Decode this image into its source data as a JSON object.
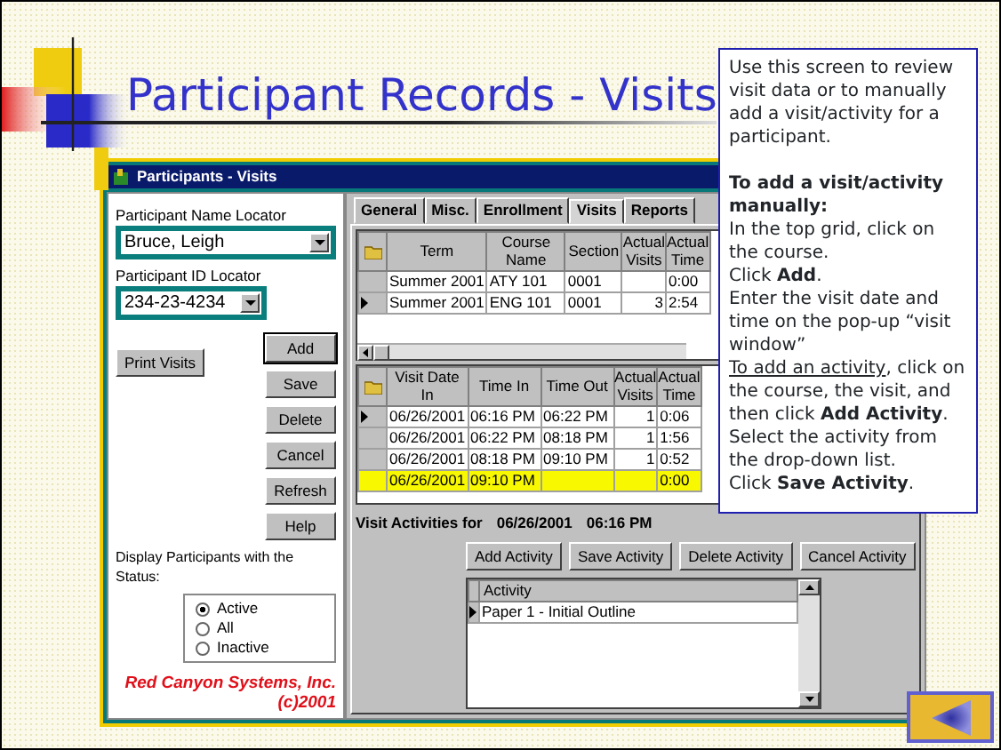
{
  "slide": {
    "title": "Participant Records - Visits"
  },
  "window": {
    "title": "Participants - Visits"
  },
  "left_panel": {
    "name_locator": {
      "label": "Participant Name Locator",
      "value": "Bruce, Leigh"
    },
    "id_locator": {
      "label": "Participant ID Locator",
      "value": "234-23-4234"
    },
    "print_button": "Print Visits",
    "buttons": [
      "Add",
      "Save",
      "Delete",
      "Cancel",
      "Refresh",
      "Help"
    ],
    "status_label": "Display Participants with the Status:",
    "status_options": [
      {
        "label": "Active",
        "selected": true
      },
      {
        "label": "All",
        "selected": false
      },
      {
        "label": "Inactive",
        "selected": false
      }
    ],
    "footer": [
      "Red Canyon Systems, Inc.",
      "(c)2001"
    ]
  },
  "tabs": [
    {
      "label": "General",
      "selected": false
    },
    {
      "label": "Misc.",
      "selected": false
    },
    {
      "label": "Enrollment",
      "selected": false
    },
    {
      "label": "Visits",
      "selected": true
    },
    {
      "label": "Reports",
      "selected": false
    }
  ],
  "courses_grid": {
    "columns": [
      "Term",
      "Course Name",
      "Section",
      "Actual Visits",
      "Actual Time"
    ],
    "rows": [
      {
        "current": false,
        "highlighted": false,
        "cells": [
          "Summer 2001",
          "ATY 101",
          "0001",
          "",
          "0:00"
        ]
      },
      {
        "current": true,
        "highlighted": false,
        "cells": [
          "Summer 2001",
          "ENG 101",
          "0001",
          "3",
          "2:54"
        ]
      }
    ]
  },
  "visits_grid": {
    "columns": [
      "Visit Date In",
      "Time In",
      "Time Out",
      "Actual Visits",
      "Actual Time"
    ],
    "rows": [
      {
        "current": true,
        "highlighted": false,
        "cells": [
          "06/26/2001",
          "06:16 PM",
          "06:22 PM",
          "1",
          "0:06"
        ]
      },
      {
        "current": false,
        "highlighted": false,
        "cells": [
          "06/26/2001",
          "06:22 PM",
          "08:18 PM",
          "1",
          "1:56"
        ]
      },
      {
        "current": false,
        "highlighted": false,
        "cells": [
          "06/26/2001",
          "08:18 PM",
          "09:10 PM",
          "1",
          "0:52"
        ]
      },
      {
        "current": false,
        "highlighted": true,
        "cells": [
          "06/26/2001",
          "09:10 PM",
          "",
          "",
          "0:00"
        ]
      }
    ]
  },
  "activities": {
    "heading": "Visit Activities for",
    "date": "06/26/2001",
    "time": "06:16 PM",
    "buttons": [
      "Add Activity",
      "Save Activity",
      "Delete Activity",
      "Cancel Activity"
    ],
    "column": "Activity",
    "rows": [
      {
        "current": true,
        "cell": "Paper 1 - Initial Outline"
      }
    ]
  },
  "callout": {
    "items": [
      {
        "kind": "text",
        "text": "Use this screen to review visit data or to manually add a visit/activity for a participant."
      },
      {
        "kind": "heading",
        "text": "**To add a visit/activity manually:**"
      },
      {
        "kind": "text",
        "text": "In the top grid, click on the course."
      },
      {
        "kind": "text",
        "text": "Click **Add**."
      },
      {
        "kind": "text",
        "text": "Enter the visit date and time on the pop-up “visit window”"
      },
      {
        "kind": "underlined_lead",
        "lead": "To add an activity",
        "text": ", click on the course, the visit, and then click **Add Activity**."
      },
      {
        "kind": "text",
        "text": "Select the activity from the drop-down list."
      },
      {
        "kind": "text",
        "text": "Click **Save Activity**."
      }
    ]
  }
}
